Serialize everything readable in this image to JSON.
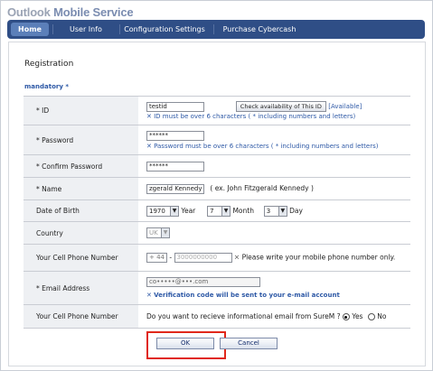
{
  "app": {
    "brand": "Outlook",
    "brand_suffix": "Mobile Service"
  },
  "nav": {
    "tabs": [
      {
        "label": "Home",
        "active": true
      },
      {
        "label": "User Info",
        "active": false
      },
      {
        "label": "Configuration Settings",
        "active": false
      },
      {
        "label": "Purchase Cybercash",
        "active": false
      }
    ]
  },
  "page": {
    "title": "Registration",
    "mandatory": "mandatory *"
  },
  "form": {
    "id": {
      "label": "* ID",
      "value": "testid",
      "check_button": "Check availability of This ID",
      "availability": "[Available]",
      "hint": "ID must be over 6 characters ( * including numbers and letters)"
    },
    "password": {
      "label": "* Password",
      "value": "******",
      "hint": "Password must be over 6 characters ( * including numbers and letters)"
    },
    "confirm_password": {
      "label": "* Confirm Password",
      "value": "******"
    },
    "name": {
      "label": "* Name",
      "value": "zgerald Kennedy",
      "example": "( ex. John Fitzgerald Kennedy )"
    },
    "dob": {
      "label": "Date of Birth",
      "year": "1970",
      "year_label": "Year",
      "month": "7",
      "month_label": "Month",
      "day": "3",
      "day_label": "Day"
    },
    "country": {
      "label": "Country",
      "value": "UK"
    },
    "phone": {
      "label": "Your Cell Phone Number",
      "prefix": "+ 44",
      "dash": "-",
      "number": "3000000000",
      "hint": "Please write your mobile phone number only."
    },
    "email": {
      "label": "* Email Address",
      "value": "co•••••@•••.com",
      "hint": "Verification code will be sent to your e-mail account"
    },
    "info_email": {
      "label": "Your Cell Phone Number",
      "question": "Do you want to recieve informational email from SureM ?",
      "yes": "Yes",
      "no": "No",
      "selected": "Yes"
    }
  },
  "actions": {
    "ok": "OK",
    "cancel": "Cancel"
  },
  "colors": {
    "nav_bg": "#2f4e86",
    "active_tab": "#5b7fb9",
    "accent_blue": "#2e59a6",
    "highlight_red": "#e0281b"
  }
}
